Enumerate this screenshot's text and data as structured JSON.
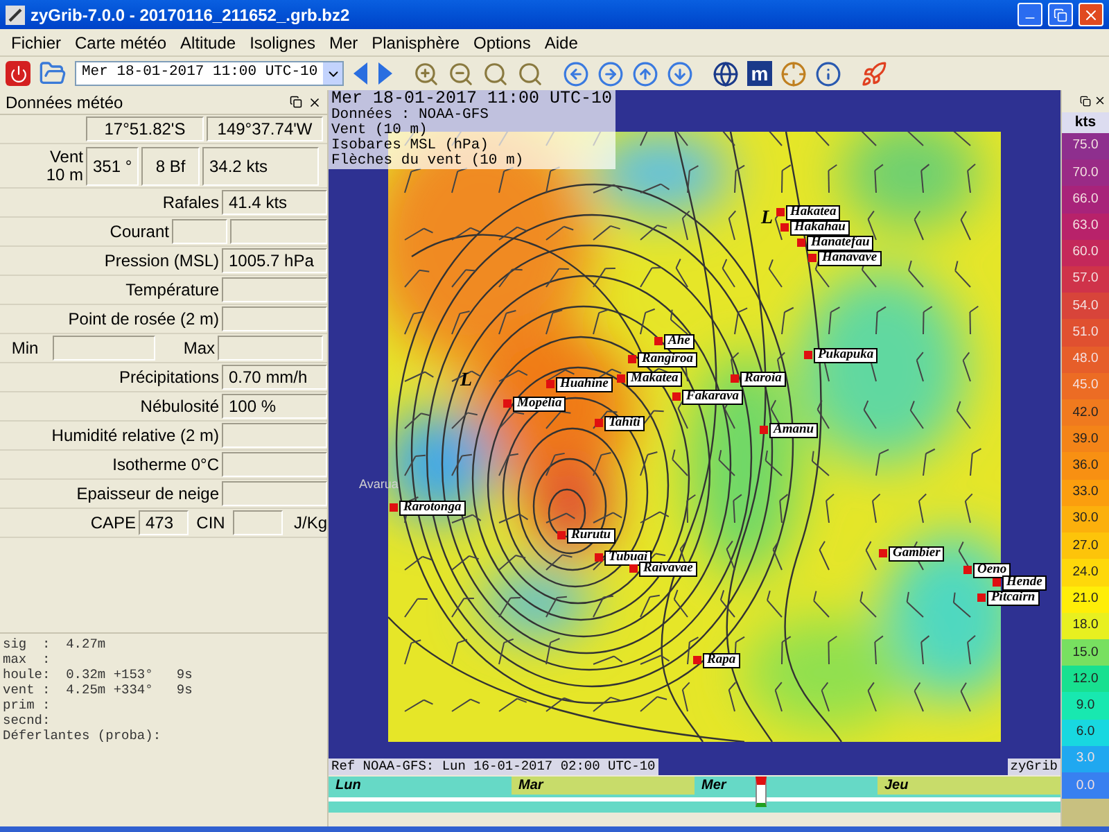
{
  "window": {
    "title": "zyGrib-7.0.0 - 20170116_211652_.grb.bz2"
  },
  "menu": [
    "Fichier",
    "Carte météo",
    "Altitude",
    "Isolignes",
    "Mer",
    "Planisphère",
    "Options",
    "Aide"
  ],
  "toolbar": {
    "date": "Mer 18-01-2017 11:00 UTC-10",
    "m_label": "m"
  },
  "panel": {
    "title": "Données météo",
    "rows": [
      {
        "kind": "coords",
        "cells": [
          "17°51.82'S",
          "149°37.74'W"
        ]
      },
      {
        "kind": "wind",
        "label": "Vent 10 m",
        "cells": [
          "351 °",
          "8 Bf",
          "34.2  kts"
        ]
      },
      {
        "kind": "value",
        "label": "Rafales",
        "value": "41.4  kts"
      },
      {
        "kind": "double",
        "label": "Courant"
      },
      {
        "kind": "value",
        "label": "Pression (MSL)",
        "value": "1005.7 hPa"
      },
      {
        "kind": "value",
        "label": "Température"
      },
      {
        "kind": "value",
        "label": "Point de rosée (2 m)"
      },
      {
        "kind": "minmax",
        "label": "Min",
        "label2": "Max"
      },
      {
        "kind": "value",
        "label": "Précipitations",
        "value": "0.70 mm/h"
      },
      {
        "kind": "value",
        "label": "Nébulosité",
        "value": "100 %"
      },
      {
        "kind": "value",
        "label": "Humidité relative (2 m)"
      },
      {
        "kind": "value",
        "label": "Isotherme 0°C"
      },
      {
        "kind": "value",
        "label": "Epaisseur de neige"
      },
      {
        "kind": "cape",
        "label": "CAPE",
        "value": "473",
        "label2": "CIN",
        "unit": "J/Kg"
      }
    ]
  },
  "sea_info": [
    "sig  :  4.27m",
    "max  :",
    "houle:  0.32m +153°   9s",
    "vent :  4.25m +334°   9s",
    "prim :",
    "secnd:",
    "Déferlantes (proba):"
  ],
  "map": {
    "info_lines": [
      "Mer 18-01-2017 11:00 UTC-10",
      "Données : NOAA-GFS",
      "Vent (10 m)",
      "Isobares MSL (hPa)",
      "Flèches du vent (10 m)"
    ],
    "pressure_marks": [
      "L",
      "L"
    ],
    "places": [
      {
        "kind": "island",
        "name": "Hakatea"
      },
      {
        "kind": "island",
        "name": "Hakahau"
      },
      {
        "kind": "island",
        "name": "Hanatefau"
      },
      {
        "kind": "island",
        "name": "Hanavave"
      },
      {
        "kind": "island",
        "name": "Ahe"
      },
      {
        "kind": "island",
        "name": "Rangiroa"
      },
      {
        "kind": "island",
        "name": "Makatea"
      },
      {
        "kind": "island",
        "name": "Fakarava"
      },
      {
        "kind": "island",
        "name": "Raroia"
      },
      {
        "kind": "island",
        "name": "Pukapuka"
      },
      {
        "kind": "island",
        "name": "Amanu"
      },
      {
        "kind": "island",
        "name": "Huahine"
      },
      {
        "kind": "island",
        "name": "Mopélia"
      },
      {
        "kind": "island",
        "name": "Tahiti"
      },
      {
        "kind": "town",
        "name": "Avarua"
      },
      {
        "kind": "island",
        "name": "Rarotonga"
      },
      {
        "kind": "island",
        "name": "Rurutu"
      },
      {
        "kind": "island",
        "name": "Tubuai"
      },
      {
        "kind": "island",
        "name": "Raivavae"
      },
      {
        "kind": "island",
        "name": "Gambier"
      },
      {
        "kind": "island",
        "name": "Oeno"
      },
      {
        "kind": "island",
        "name": "Hende"
      },
      {
        "kind": "island",
        "name": "Pitcairn"
      },
      {
        "kind": "island",
        "name": "Rapa"
      }
    ],
    "ref": "Ref NOAA-GFS: Lun 16-01-2017 02:00 UTC-10",
    "brand": "zyGrib"
  },
  "timeline": {
    "level": 0.59,
    "days": [
      {
        "label": "Lun",
        "color": "#66d9c6"
      },
      {
        "label": "Mar",
        "color": "#c8dc6a"
      },
      {
        "label": "Mer",
        "color": "#66d9c6"
      },
      {
        "label": "Jeu",
        "color": "#c8dc6a"
      }
    ]
  },
  "legend": {
    "unit": "kts",
    "items": [
      {
        "label": "75.0",
        "color": "#8e2f8e"
      },
      {
        "label": "70.0",
        "color": "#9a2a86"
      },
      {
        "label": "66.0",
        "color": "#a8237a"
      },
      {
        "label": "63.0",
        "color": "#b8226a"
      },
      {
        "label": "60.0",
        "color": "#c4285a"
      },
      {
        "label": "57.0",
        "color": "#cf334a"
      },
      {
        "label": "54.0",
        "color": "#d8443a"
      },
      {
        "label": "51.0",
        "color": "#e05030"
      },
      {
        "label": "48.0",
        "color": "#e65e2a"
      },
      {
        "label": "45.0",
        "color": "#ec6c24"
      },
      {
        "label": "42.0",
        "color": "#f07a1e"
      },
      {
        "label": "39.0",
        "color": "#f48418"
      },
      {
        "label": "36.0",
        "color": "#f89012"
      },
      {
        "label": "33.0",
        "color": "#fb9e0e"
      },
      {
        "label": "30.0",
        "color": "#fcb00c"
      },
      {
        "label": "27.0",
        "color": "#fdc40a"
      },
      {
        "label": "24.0",
        "color": "#fed80a"
      },
      {
        "label": "21.0",
        "color": "#ffee08"
      },
      {
        "label": "18.0",
        "color": "#e8f020"
      },
      {
        "label": "15.0",
        "color": "#78e060"
      },
      {
        "label": "12.0",
        "color": "#18e090"
      },
      {
        "label": "9.0",
        "color": "#18e8b0"
      },
      {
        "label": "6.0",
        "color": "#18d8e0"
      },
      {
        "label": "3.0",
        "color": "#20a8f0"
      },
      {
        "label": "0.0",
        "color": "#3880f0"
      }
    ]
  }
}
